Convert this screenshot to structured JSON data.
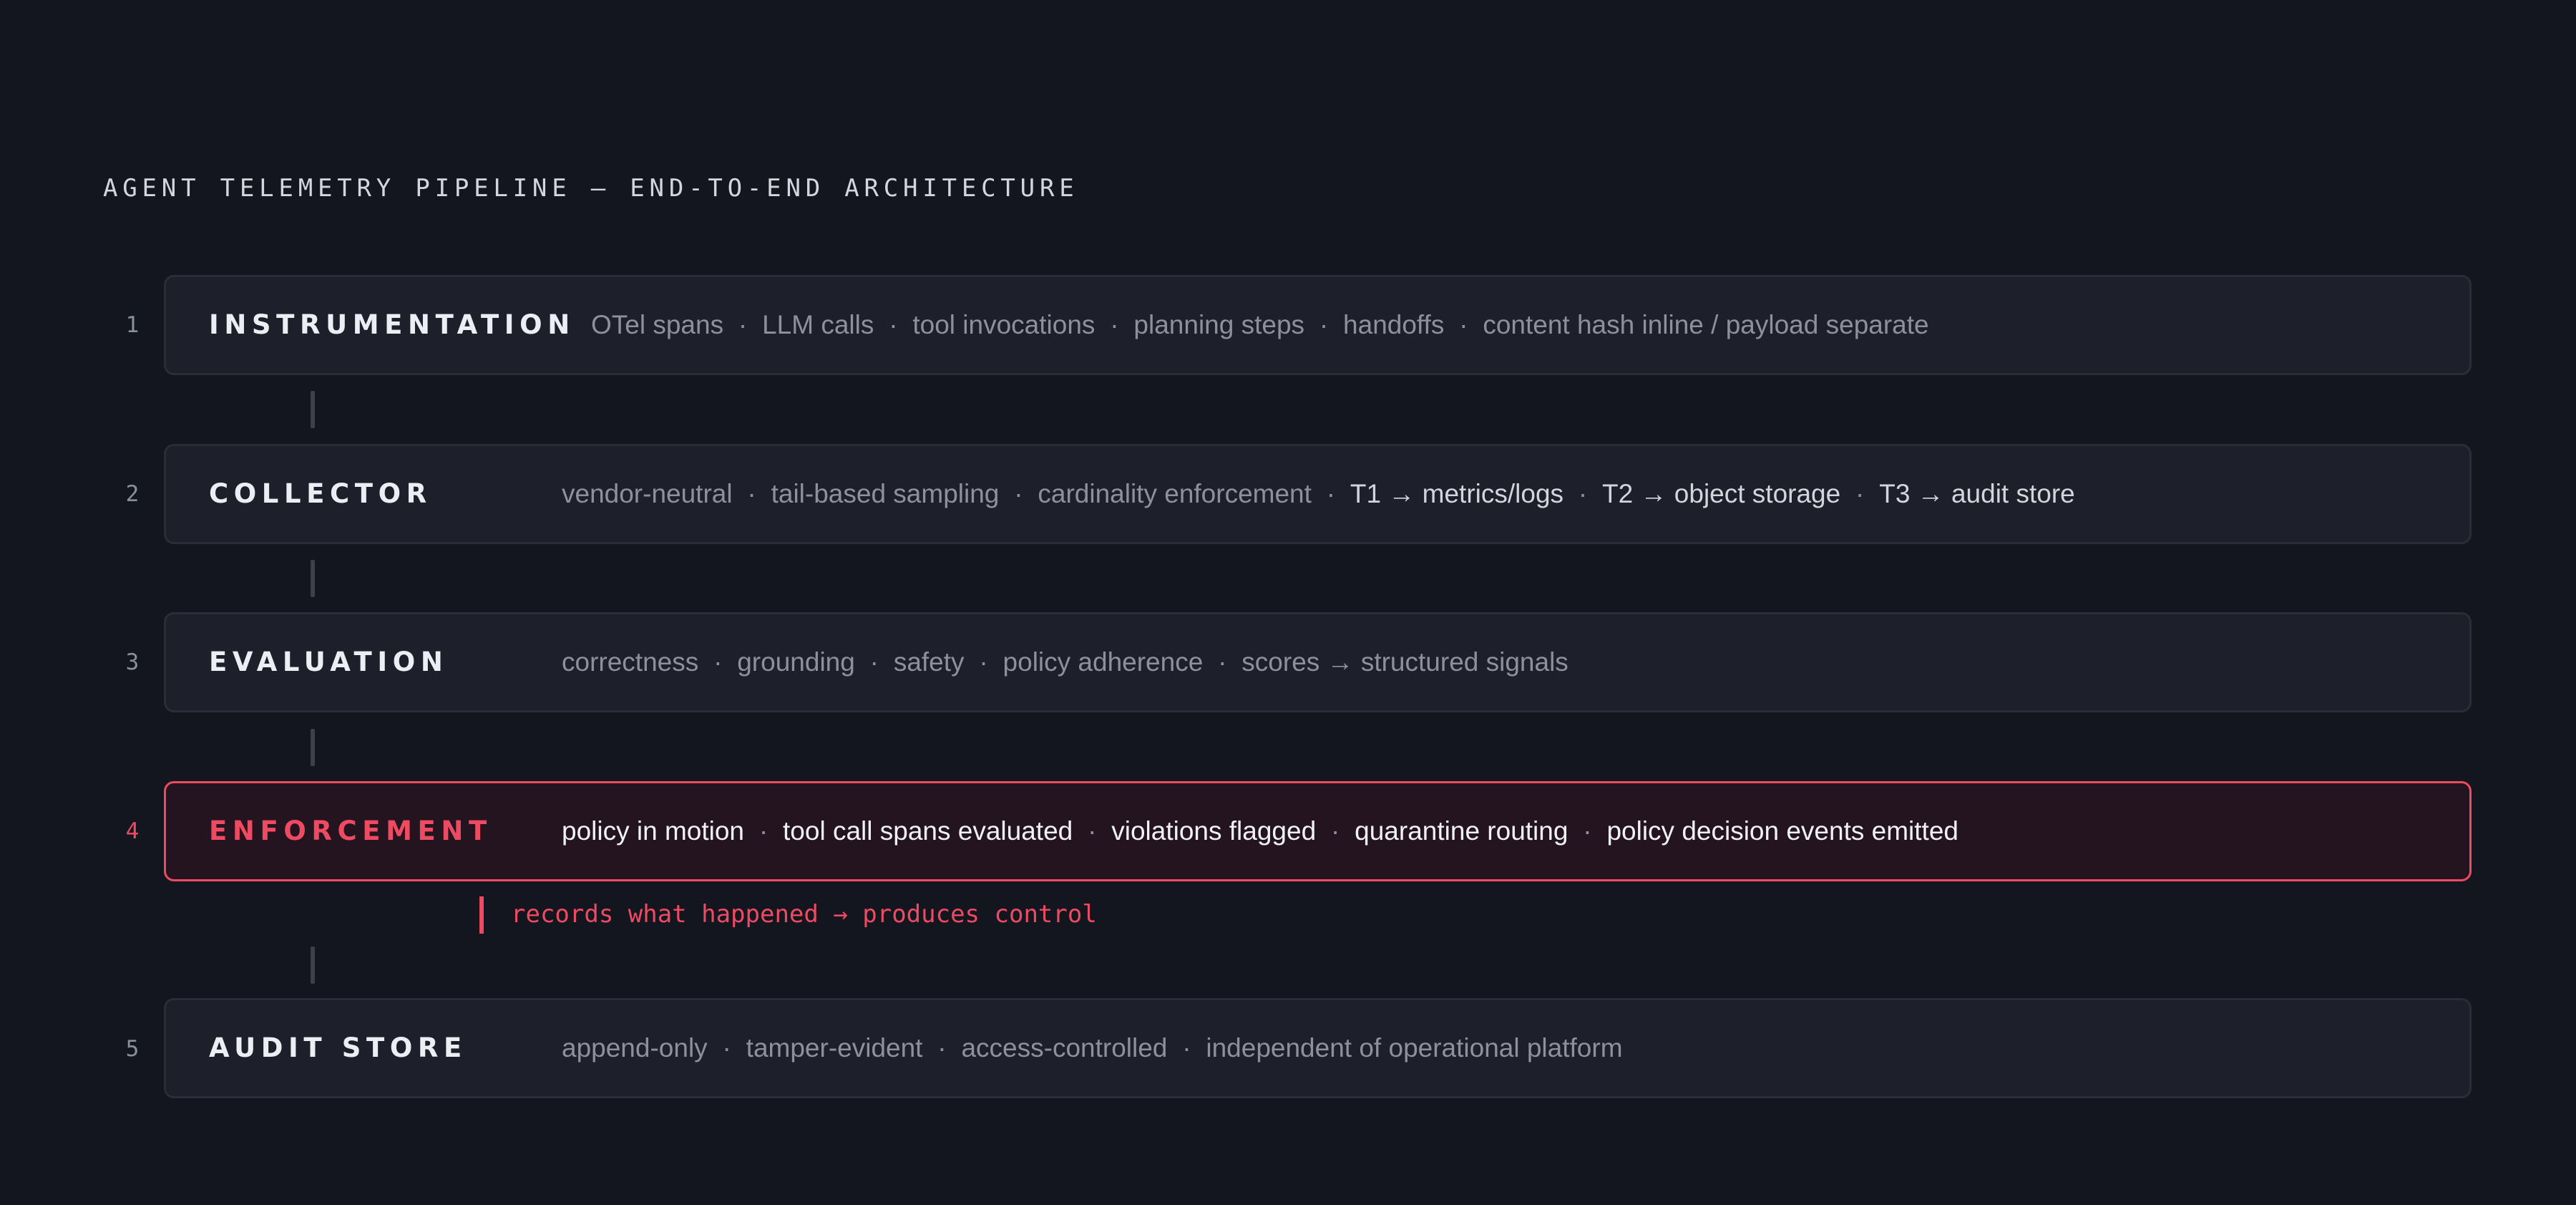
{
  "title": "AGENT TELEMETRY PIPELINE — END-TO-END ARCHITECTURE",
  "colors": {
    "background": "#13161e",
    "panel": "#1d1f2a",
    "accent": "#ee4a62",
    "muted_text": "#8e919d",
    "bright_text": "#eceef4"
  },
  "stages": [
    {
      "number": "1",
      "name": "INSTRUMENTATION",
      "items": [
        "OTel spans",
        "LLM calls",
        "tool invocations",
        "planning steps",
        "handoffs",
        "content hash inline / payload separate"
      ]
    },
    {
      "number": "2",
      "name": "COLLECTOR",
      "items": [
        "vendor-neutral",
        "tail-based sampling",
        "cardinality enforcement",
        "T1 → metrics/logs",
        "T2 → object storage",
        "T3 → audit store"
      ]
    },
    {
      "number": "3",
      "name": "EVALUATION",
      "items": [
        "correctness",
        "grounding",
        "safety",
        "policy adherence",
        "scores → structured signals"
      ]
    },
    {
      "number": "4",
      "name": "ENFORCEMENT",
      "items": [
        "policy in motion",
        "tool call spans evaluated",
        "violations flagged",
        "quarantine routing",
        "policy decision events emitted"
      ],
      "note": "records what happened → produces control"
    },
    {
      "number": "5",
      "name": "AUDIT STORE",
      "items": [
        "append-only",
        "tamper-evident",
        "access-controlled",
        "independent of operational platform"
      ]
    }
  ],
  "separator": "·"
}
